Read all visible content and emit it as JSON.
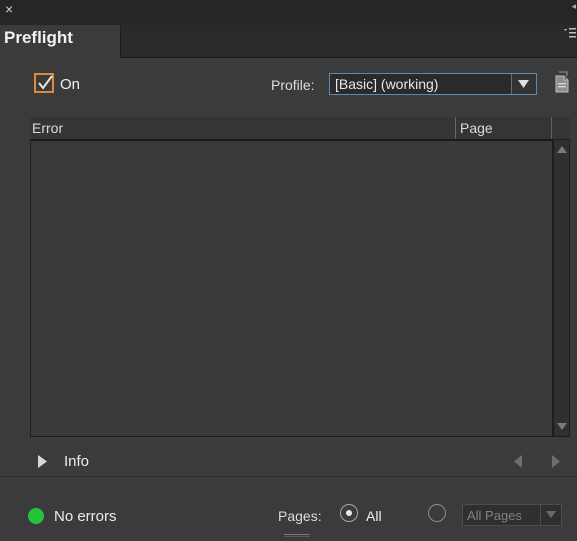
{
  "window": {
    "close_glyph": "×"
  },
  "tab": {
    "label": "Preflight"
  },
  "controls": {
    "on_label": "On",
    "on_checked": true,
    "profile_label": "Profile:",
    "profile_value": "[Basic] (working)"
  },
  "table": {
    "columns": [
      "Error",
      "Page"
    ],
    "rows": []
  },
  "info": {
    "label": "Info"
  },
  "status": {
    "text": "No errors",
    "indicator_color": "#27c33a"
  },
  "pages": {
    "label": "Pages:",
    "all_label": "All",
    "all_selected": true,
    "range_value": "All Pages"
  },
  "colors": {
    "accent_check": "#e0893a",
    "panel_bg": "#3b3b3b"
  },
  "icons": [
    "close-icon",
    "panel-menu-icon",
    "dropdown-arrow-icon",
    "profile-menu-icon",
    "scroll-up-icon",
    "scroll-down-icon",
    "disclosure-triangle-icon",
    "previous-icon",
    "next-icon",
    "status-indicator-icon",
    "resize-grip-icon"
  ]
}
